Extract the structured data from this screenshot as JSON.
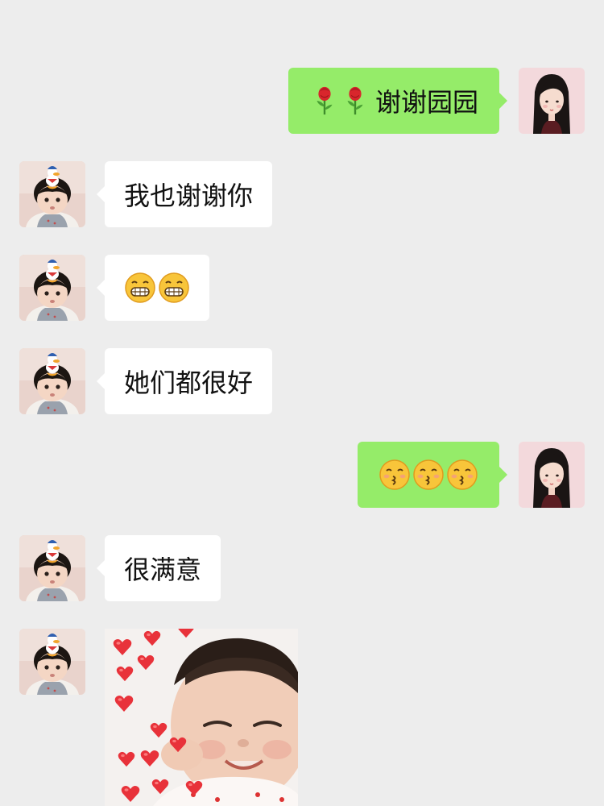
{
  "messages": [
    {
      "side": "right",
      "text": "谢谢园园",
      "prefix_icons": [
        "rose-icon",
        "rose-icon"
      ],
      "avatar": "me-avatar"
    },
    {
      "side": "left",
      "text": "我也谢谢你",
      "avatar": "friend-avatar"
    },
    {
      "side": "left",
      "emoji": [
        "grin-icon",
        "grin-icon"
      ],
      "avatar": "friend-avatar"
    },
    {
      "side": "left",
      "text": "她们都很好",
      "avatar": "friend-avatar"
    },
    {
      "side": "right",
      "emoji": [
        "kissing-icon",
        "kissing-icon",
        "kissing-icon"
      ],
      "avatar": "me-avatar"
    },
    {
      "side": "left",
      "text": "很满意",
      "avatar": "friend-avatar"
    },
    {
      "side": "left",
      "sticker": "baby-hearts-sticker",
      "avatar": "friend-avatar"
    }
  ],
  "colors": {
    "background": "#ededed",
    "incoming_bubble": "#ffffff",
    "outgoing_bubble": "#95ec69",
    "heart": "#e8323a"
  }
}
